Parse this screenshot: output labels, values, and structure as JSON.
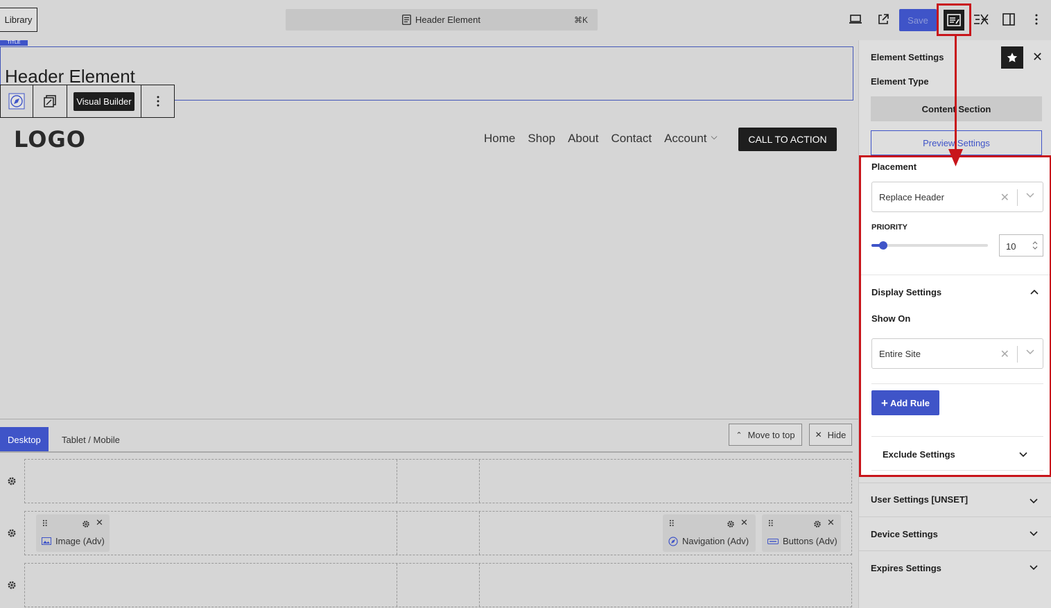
{
  "topbar": {
    "library_label": "Library",
    "command_title": "Header Element",
    "command_shortcut": "⌘K",
    "save_label": "Save"
  },
  "canvas": {
    "block_tag": "TITLE",
    "page_heading": "Header Element",
    "toolbar_visual_builder": "Visual Builder",
    "logo_text": "LOGO",
    "nav_items": [
      "Home",
      "Shop",
      "About",
      "Contact",
      "Account"
    ],
    "cta_label": "CALL TO ACTION"
  },
  "builder": {
    "tab_desktop": "Desktop",
    "tab_tablet": "Tablet / Mobile",
    "move_to_top": "Move to top",
    "hide": "Hide",
    "elements": {
      "image": "Image (Adv)",
      "navigation": "Navigation (Adv)",
      "buttons": "Buttons (Adv)"
    }
  },
  "sidebar": {
    "title": "Element Settings",
    "element_type_label": "Element Type",
    "element_type_value": "Content Section",
    "preview_settings": "Preview Settings",
    "placement_label": "Placement",
    "placement_value": "Replace Header",
    "priority_label": "PRIORITY",
    "priority_value": "10",
    "priority_fraction": 0.1,
    "display_settings_label": "Display Settings",
    "show_on_label": "Show On",
    "show_on_value": "Entire Site",
    "add_rule_label": "Add Rule",
    "exclude_settings_label": "Exclude Settings",
    "user_settings_label": "User Settings [UNSET]",
    "device_settings_label": "Device Settings",
    "expires_settings_label": "Expires Settings"
  },
  "colors": {
    "accent": "#3f54c8",
    "highlight_red": "#c8151b",
    "dark": "#1e1e1e"
  }
}
